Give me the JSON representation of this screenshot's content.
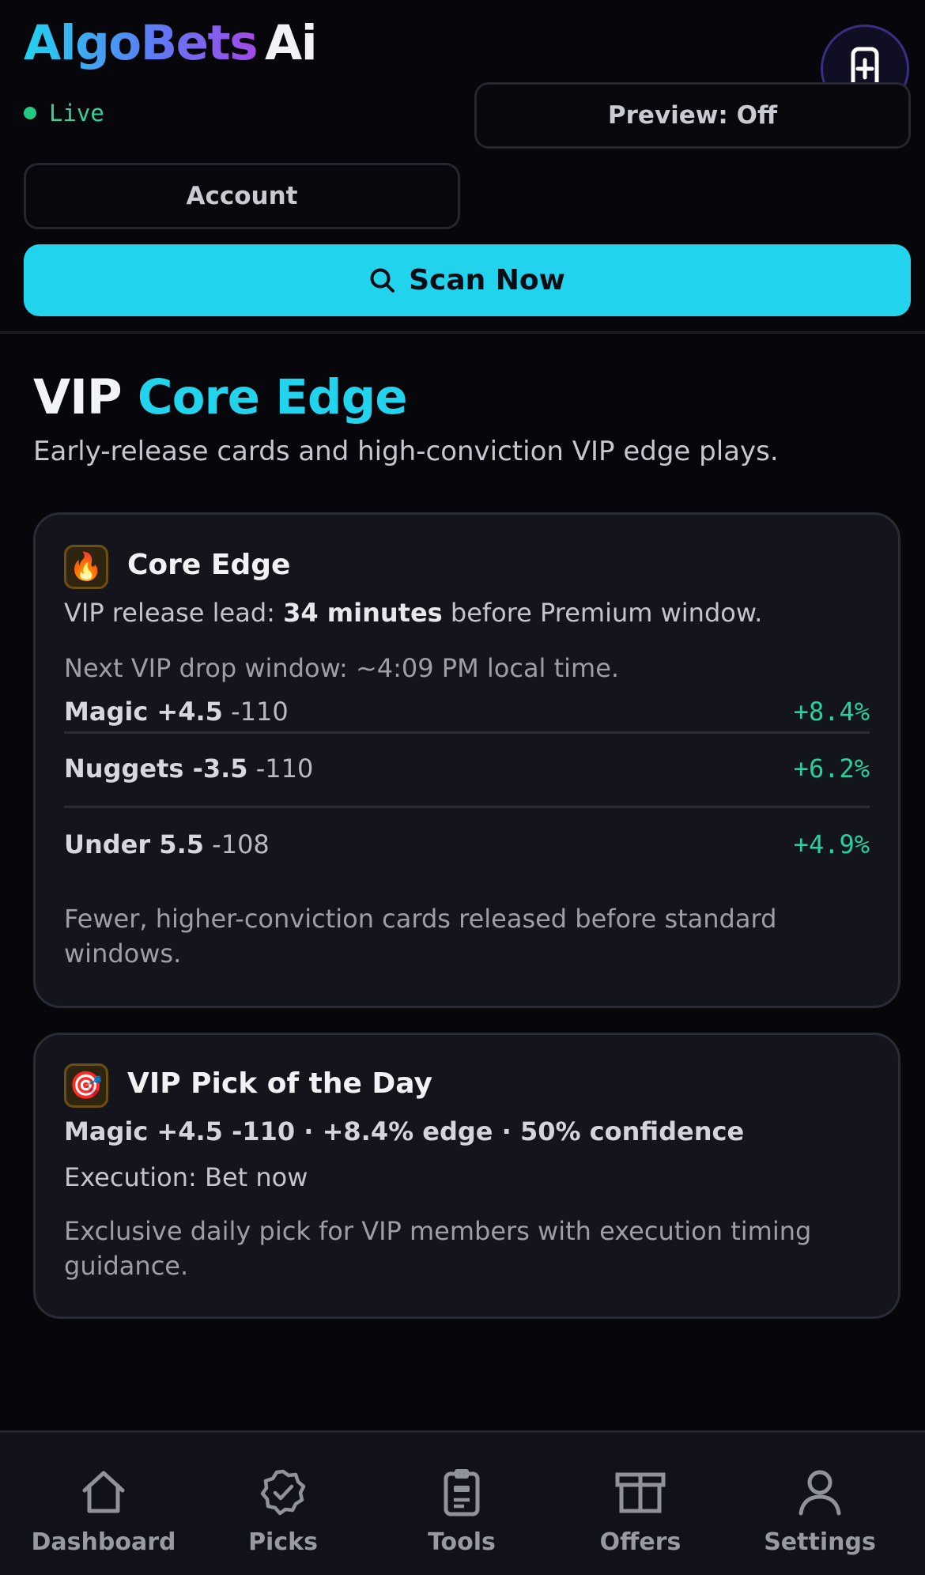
{
  "brand": {
    "name_part1": "AlgoBets",
    "name_part2": "Ai"
  },
  "status": {
    "live_label": "Live"
  },
  "header": {
    "preview_label": "Preview: Off",
    "account_label": "Account",
    "scan_label": "Scan Now",
    "fab_icon": "phone-plus-icon"
  },
  "page": {
    "title_part1": "VIP",
    "title_part2": "Core Edge",
    "subtitle": "Early-release cards and high-conviction VIP edge plays."
  },
  "core_edge": {
    "icon": "🔥",
    "title": "Core Edge",
    "lead_prefix": "VIP release lead: ",
    "lead_value": "34 minutes",
    "lead_suffix": " before Premium window.",
    "next_drop": "Next VIP drop window: ~4:09 PM local time.",
    "picks": [
      {
        "name": "Magic +4.5",
        "odds": "-110",
        "edge": "+8.4%"
      },
      {
        "name": "Nuggets -3.5",
        "odds": "-110",
        "edge": "+6.2%"
      },
      {
        "name": "Under 5.5",
        "odds": "-108",
        "edge": "+4.9%"
      }
    ],
    "footer": "Fewer, higher-conviction cards released before standard windows."
  },
  "pick_of_day": {
    "icon": "🎯",
    "title": "VIP Pick of the Day",
    "summary": "Magic +4.5 -110 · +8.4% edge · 50% confidence",
    "execution": "Execution: Bet now",
    "footer": "Exclusive daily pick for VIP members with execution timing guidance."
  },
  "nav": {
    "items": [
      {
        "label": "Dashboard",
        "icon": "home-icon"
      },
      {
        "label": "Picks",
        "icon": "badge-check-icon"
      },
      {
        "label": "Tools",
        "icon": "clipboard-icon"
      },
      {
        "label": "Offers",
        "icon": "gift-icon"
      },
      {
        "label": "Settings",
        "icon": "user-icon"
      }
    ]
  },
  "colors": {
    "accent": "#22d3ee",
    "positive": "#22d3a0",
    "live": "#34d399",
    "background": "#06060b",
    "card": "#14151c"
  }
}
